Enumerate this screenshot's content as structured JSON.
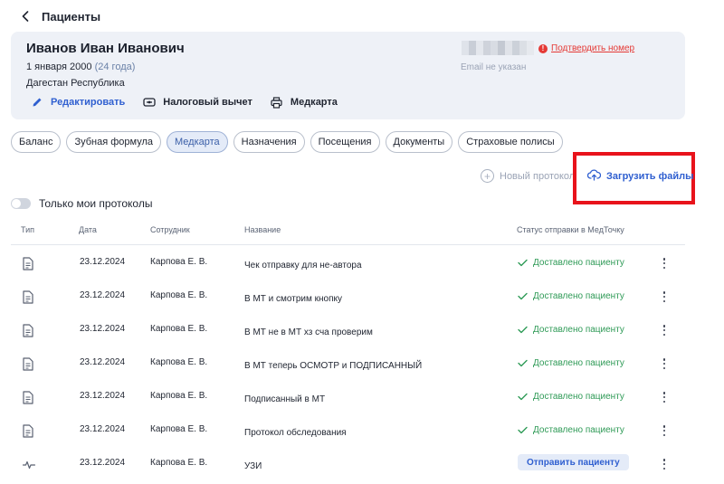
{
  "header": {
    "back_icon": "chevron-left-icon",
    "title": "Пациенты"
  },
  "patient": {
    "name": "Иванов Иван Иванович",
    "birth_date": "1 января 2000",
    "age": "(24 года)",
    "region": "Дагестан Республика",
    "confirm_phone": "Подтвердить номер",
    "email": "Email не указан"
  },
  "actions": {
    "edit": "Редактировать",
    "tax": "Налоговый вычет",
    "medcard": "Медкарта"
  },
  "tabs": [
    "Баланс",
    "Зубная формула",
    "Медкарта",
    "Назначения",
    "Посещения",
    "Документы",
    "Страховые полисы"
  ],
  "active_tab": "Медкарта",
  "toolbar": {
    "new_protocol": "Новый протокол",
    "upload": "Загрузить файлы",
    "only_mine": "Только мои протоколы"
  },
  "table": {
    "headers": {
      "type": "Тип",
      "date": "Дата",
      "employee": "Сотрудник",
      "name": "Название",
      "status": "Статус отправки в МедТочку"
    },
    "rows": [
      {
        "icon": "document-icon",
        "date": "23.12.2024",
        "employee": "Карпова Е. В.",
        "name": "Чек отправку для не-автора",
        "status": "Доставлено пациенту"
      },
      {
        "icon": "document-icon",
        "date": "23.12.2024",
        "employee": "Карпова Е. В.",
        "name": "В МТ и смотрим кнопку",
        "status": "Доставлено пациенту"
      },
      {
        "icon": "document-icon",
        "date": "23.12.2024",
        "employee": "Карпова Е. В.",
        "name": "В МТ не в МТ хз сча проверим",
        "status": "Доставлено пациенту"
      },
      {
        "icon": "document-icon",
        "date": "23.12.2024",
        "employee": "Карпова Е. В.",
        "name": "В МТ теперь ОСМОТР и ПОДПИСАННЫЙ",
        "status": "Доставлено пациенту"
      },
      {
        "icon": "document-icon",
        "date": "23.12.2024",
        "employee": "Карпова Е. В.",
        "name": "Подписанный в МТ",
        "status": "Доставлено пациенту"
      },
      {
        "icon": "document-icon",
        "date": "23.12.2024",
        "employee": "Карпова Е. В.",
        "name": "Протокол обследования",
        "status": "Доставлено пациенту"
      },
      {
        "icon": "pulse-icon",
        "date": "23.12.2024",
        "employee": "Карпова Е. В.",
        "name": "УЗИ",
        "send_button": "Отправить пациенту"
      }
    ]
  },
  "colors": {
    "accent": "#2f5fd0",
    "success": "#2e9a56",
    "error": "#e53935",
    "highlight": "#e8131b",
    "card_bg": "#eef1f7"
  }
}
